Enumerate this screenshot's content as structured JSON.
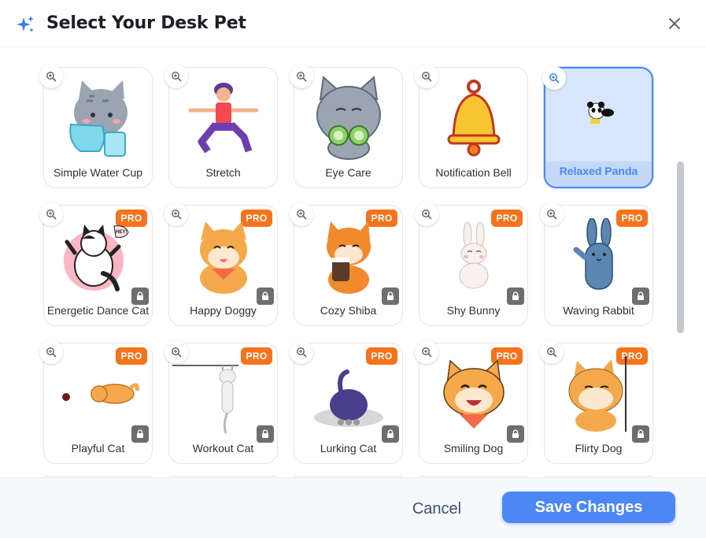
{
  "header": {
    "title": "Select Your Desk Pet",
    "icon": "sparkle-icon",
    "close_icon": "close-icon"
  },
  "pets": [
    {
      "name": "Simple Water Cup",
      "pro": false,
      "selected": false
    },
    {
      "name": "Stretch",
      "pro": false,
      "selected": false
    },
    {
      "name": "Eye Care",
      "pro": false,
      "selected": false
    },
    {
      "name": "Notification Bell",
      "pro": false,
      "selected": false
    },
    {
      "name": "Relaxed Panda",
      "pro": false,
      "selected": true
    },
    {
      "name": "Energetic Dance Cat",
      "pro": true,
      "selected": false
    },
    {
      "name": "Happy Doggy",
      "pro": true,
      "selected": false
    },
    {
      "name": "Cozy Shiba",
      "pro": true,
      "selected": false
    },
    {
      "name": "Shy Bunny",
      "pro": true,
      "selected": false
    },
    {
      "name": "Waving Rabbit",
      "pro": true,
      "selected": false
    },
    {
      "name": "Playful Cat",
      "pro": true,
      "selected": false
    },
    {
      "name": "Workout Cat",
      "pro": true,
      "selected": false
    },
    {
      "name": "Lurking Cat",
      "pro": true,
      "selected": false
    },
    {
      "name": "Smiling Dog",
      "pro": true,
      "selected": false
    },
    {
      "name": "Flirty Dog",
      "pro": true,
      "selected": false
    }
  ],
  "badge": {
    "pro_label": "PRO"
  },
  "cat_speech": "HEY!",
  "footer": {
    "cancel_label": "Cancel",
    "save_label": "Save Changes"
  },
  "colors": {
    "accent": "#4b88f3",
    "pro_badge": "#f4731c",
    "selected_bg": "#d7e6fc",
    "lock_bg": "#6e6e6e"
  }
}
